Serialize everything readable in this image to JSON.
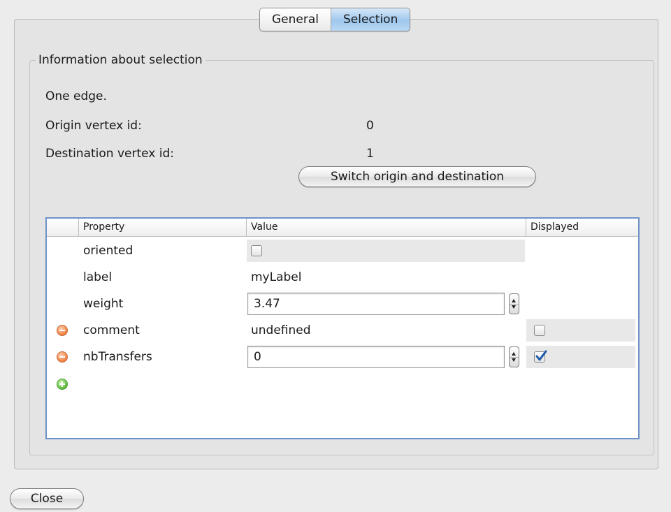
{
  "tabs": [
    {
      "label": "General",
      "selected": false
    },
    {
      "label": "Selection",
      "selected": true
    }
  ],
  "group": {
    "title": "Information about selection",
    "summary": "One edge.",
    "origin_label": "Origin vertex id:",
    "origin_value": "0",
    "destination_label": "Destination vertex id:",
    "destination_value": "1",
    "switch_button_label": "Switch origin and destination"
  },
  "table": {
    "headers": [
      "Property",
      "Value",
      "Displayed"
    ],
    "rows": [
      {
        "name": "oriented",
        "value": "",
        "value_kind": "checkbox",
        "value_checked": false,
        "removable": false,
        "displayed": null
      },
      {
        "name": "label",
        "value": "myLabel",
        "value_kind": "text",
        "removable": false,
        "displayed": null
      },
      {
        "name": "weight",
        "value": "3.47",
        "value_kind": "number",
        "removable": false,
        "displayed": null
      },
      {
        "name": "comment",
        "value": "undefined",
        "value_kind": "text",
        "removable": true,
        "displayed": false
      },
      {
        "name": "nbTransfers",
        "value": "0",
        "value_kind": "number",
        "removable": true,
        "displayed": true
      }
    ]
  },
  "icons": {
    "remove": "remove-property-icon",
    "add": "add-property-icon",
    "checkmark": "checkmark-icon"
  },
  "colors": {
    "selected_tab": "#9ec7ec",
    "table_border": "#6e93c8",
    "checkmark": "#1f5aa8",
    "remove_icon": "#f28a4e",
    "add_icon": "#6cc24a"
  },
  "footer": {
    "close_label": "Close"
  }
}
